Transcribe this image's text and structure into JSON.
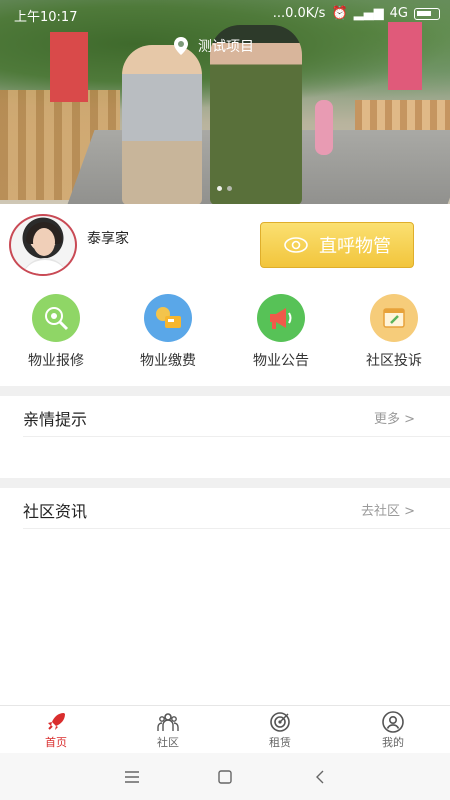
{
  "status": {
    "time": "上午10:17",
    "net": "...0.0K/s",
    "signal": "4G"
  },
  "hero": {
    "location": "测试项目"
  },
  "profile": {
    "name": "泰享家",
    "call_button": "直呼物管"
  },
  "services": [
    {
      "label": "物业报修",
      "icon": "repair-icon",
      "color": "#7ccf5a"
    },
    {
      "label": "物业缴费",
      "icon": "payment-icon",
      "color": "#5aa7e8"
    },
    {
      "label": "物业公告",
      "icon": "announcement-icon",
      "color": "#57c257"
    },
    {
      "label": "社区投诉",
      "icon": "complaint-icon",
      "color": "#f4c673"
    }
  ],
  "sections": {
    "tips": {
      "title": "亲情提示",
      "more": "更多 >"
    },
    "news": {
      "title": "社区资讯",
      "more": "去社区 >"
    }
  },
  "tabbar": [
    {
      "label": "首页",
      "icon": "rocket-icon",
      "active": true
    },
    {
      "label": "社区",
      "icon": "community-icon",
      "active": false
    },
    {
      "label": "租赁",
      "icon": "target-icon",
      "active": false
    },
    {
      "label": "我的",
      "icon": "user-icon",
      "active": false
    }
  ],
  "colors": {
    "accent": "#d92d2d",
    "call_button": "#f2c53c"
  }
}
